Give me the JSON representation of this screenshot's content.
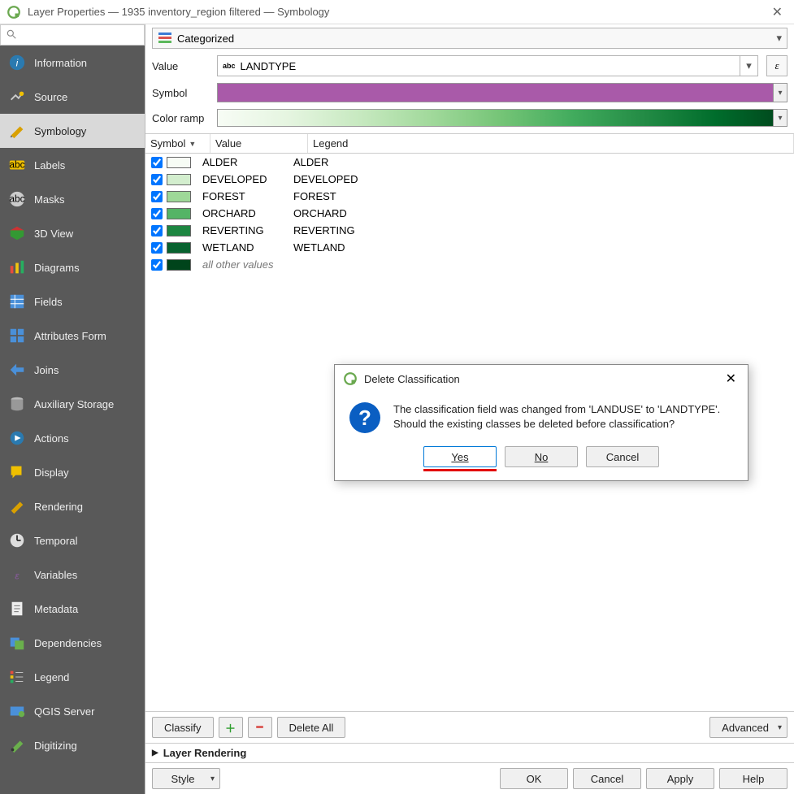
{
  "window": {
    "title": "Layer Properties — 1935 inventory_region filtered — Symbology"
  },
  "search": {
    "placeholder": ""
  },
  "sidebar": {
    "items": [
      {
        "label": "Information"
      },
      {
        "label": "Source"
      },
      {
        "label": "Symbology"
      },
      {
        "label": "Labels"
      },
      {
        "label": "Masks"
      },
      {
        "label": "3D View"
      },
      {
        "label": "Diagrams"
      },
      {
        "label": "Fields"
      },
      {
        "label": "Attributes Form"
      },
      {
        "label": "Joins"
      },
      {
        "label": "Auxiliary Storage"
      },
      {
        "label": "Actions"
      },
      {
        "label": "Display"
      },
      {
        "label": "Rendering"
      },
      {
        "label": "Temporal"
      },
      {
        "label": "Variables"
      },
      {
        "label": "Metadata"
      },
      {
        "label": "Dependencies"
      },
      {
        "label": "Legend"
      },
      {
        "label": "QGIS Server"
      },
      {
        "label": "Digitizing"
      }
    ],
    "active_index": 2
  },
  "symbology": {
    "renderer": "Categorized",
    "value_label": "Value",
    "value_field": "LANDTYPE",
    "symbol_label": "Symbol",
    "symbol_color": "#a95aa9",
    "colorramp_label": "Color ramp",
    "headers": {
      "symbol": "Symbol",
      "value": "Value",
      "legend": "Legend"
    },
    "rows": [
      {
        "color": "#f7fcf5",
        "value": "ALDER",
        "legend": "ALDER"
      },
      {
        "color": "#d3eece",
        "value": "DEVELOPED",
        "legend": "DEVELOPED"
      },
      {
        "color": "#9ed898",
        "value": "FOREST",
        "legend": "FOREST"
      },
      {
        "color": "#54b466",
        "value": "ORCHARD",
        "legend": "ORCHARD"
      },
      {
        "color": "#1d8641",
        "value": "REVERTING",
        "legend": "REVERTING"
      },
      {
        "color": "#08622f",
        "value": "WETLAND",
        "legend": "WETLAND"
      },
      {
        "color": "#00441b",
        "value": "all other values",
        "legend": "",
        "other": true
      }
    ]
  },
  "classify_bar": {
    "classify": "Classify",
    "delete_all": "Delete All",
    "advanced": "Advanced"
  },
  "render_section": {
    "title": "Layer Rendering"
  },
  "bottom_bar": {
    "style": "Style",
    "ok": "OK",
    "cancel": "Cancel",
    "apply": "Apply",
    "help": "Help"
  },
  "modal": {
    "title": "Delete Classification",
    "line1": "The classification field was changed from 'LANDUSE' to 'LANDTYPE'.",
    "line2": "Should the existing classes be deleted before classification?",
    "yes": "Yes",
    "no": "No",
    "cancel": "Cancel"
  }
}
